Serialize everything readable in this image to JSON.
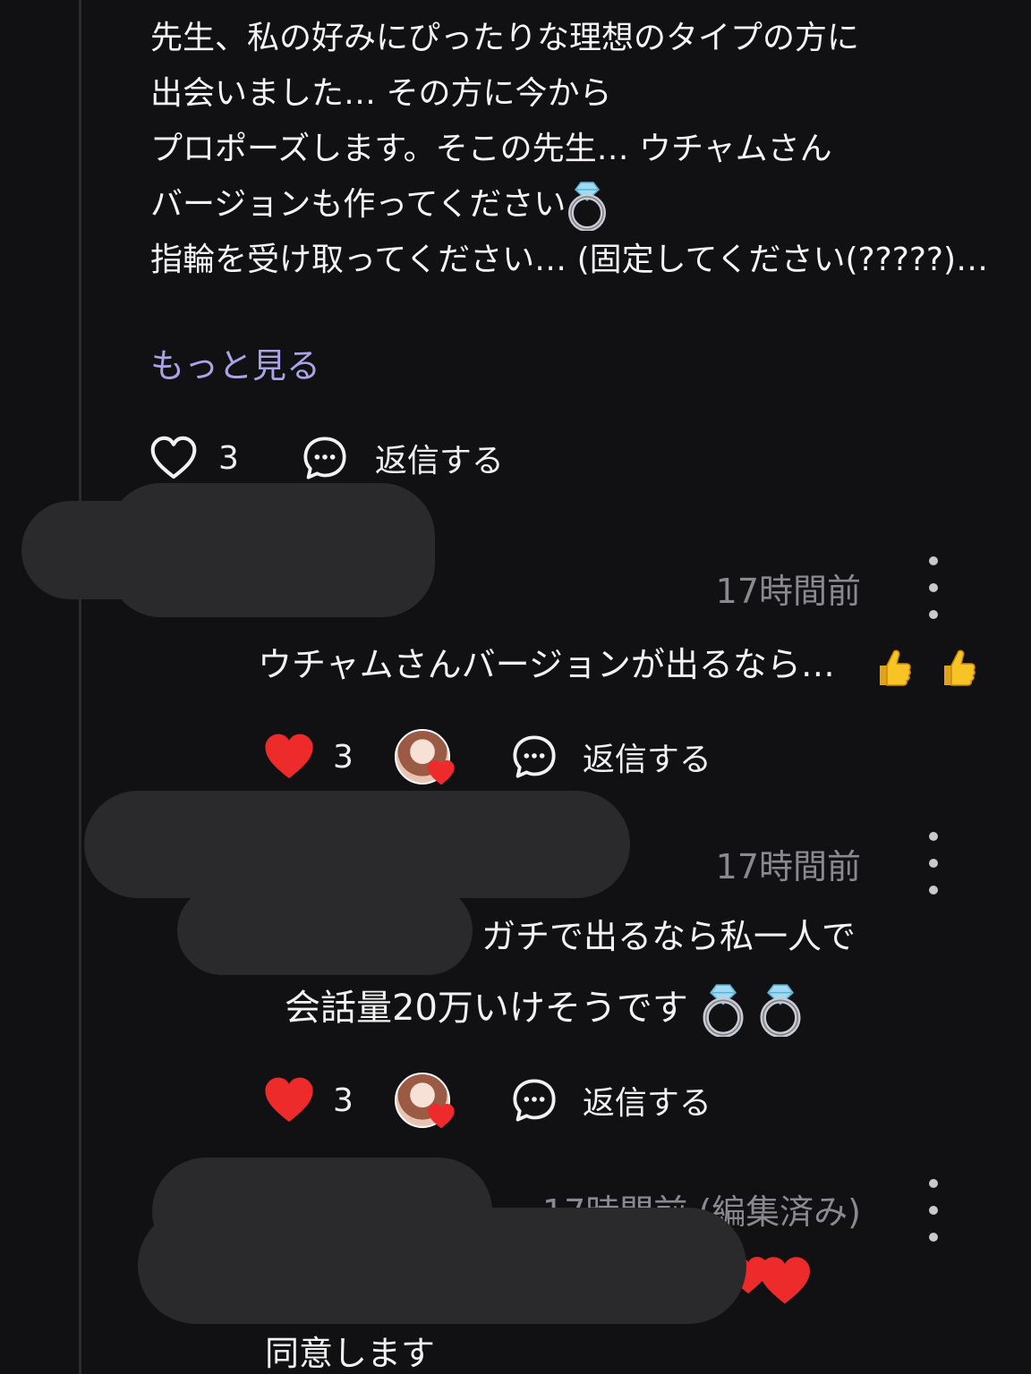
{
  "original_comment": {
    "lines": [
      "先生、私の好みにぴったりな理想のタイプの方に",
      "出会いました… その方に今から",
      "プロポーズします。そこの先生… ウチャムさん",
      "バージョンも作ってください",
      "指輪を受け取ってください… (固定してください(?????)…"
    ],
    "see_more": "もっと見る",
    "like_count": "3",
    "reply_label": "返信する"
  },
  "replies": [
    {
      "timestamp": "17時間前",
      "text": "ウチャムさんバージョンが出るなら…",
      "like_count": "3",
      "reply_label": "返信する"
    },
    {
      "timestamp": "17時間前",
      "line1": "ガチで出るなら私一人で",
      "line2": "会話量20万いけそうです",
      "like_count": "3",
      "reply_label": "返信する"
    },
    {
      "timestamp": "17時間前 (編集済み)",
      "text": "同意します"
    }
  ],
  "icons": {
    "like_outline": "heart-outline-icon",
    "like_filled": "heart-filled-icon",
    "reply": "chat-bubble-icon",
    "more": "kebab-menu-icon",
    "ring_emoji": "ring-icon",
    "thumbs_up_emoji": "thumbs-up-icon"
  },
  "colors": {
    "background": "#111113",
    "text": "#f2f2f2",
    "timestamp": "#8a8a8e",
    "see_more": "#a9a4e8",
    "heart": "#ee2b2b"
  }
}
